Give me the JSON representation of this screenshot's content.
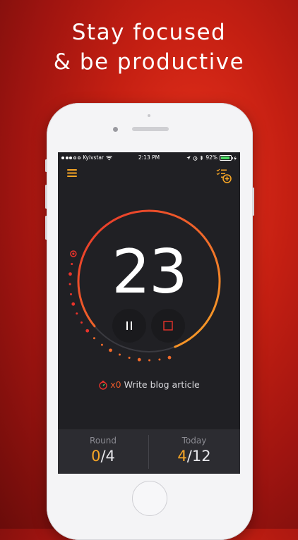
{
  "headline": {
    "line1": "Stay focused",
    "line2": "& be productive"
  },
  "statusbar": {
    "carrier": "Kyivstar",
    "time": "2:13 PM",
    "battery": "92%",
    "battery_level": 0.92
  },
  "icons": {
    "menu": "hamburger-menu-icon",
    "add_task": "checklist-add-icon",
    "pause": "pause-icon",
    "stop": "stop-icon",
    "task": "stopwatch-icon"
  },
  "timer": {
    "value": "23",
    "progress": 0.8
  },
  "task": {
    "count": "x0",
    "name": "Write blog article"
  },
  "stats": {
    "round": {
      "label": "Round",
      "current": "0",
      "total": "/4"
    },
    "today": {
      "label": "Today",
      "current": "4",
      "total": "/12"
    }
  },
  "colors": {
    "accent_orange": "#f7a626",
    "accent_red": "#e8332b",
    "screen_bg": "#202024",
    "bottom_bg": "#2c2c31"
  }
}
